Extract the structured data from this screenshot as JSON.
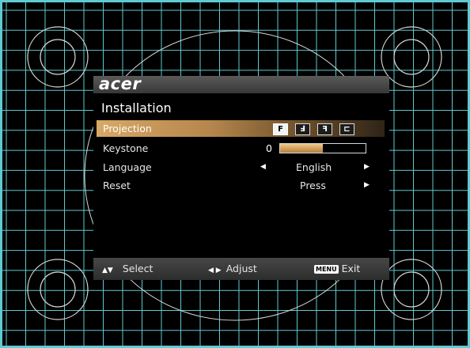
{
  "osd": {
    "brand": "acer",
    "title": "Installation",
    "menu": {
      "projection": {
        "label": "Projection",
        "modes": [
          {
            "icon": "front-desktop-projection-icon",
            "glyph": "F",
            "selected": true
          },
          {
            "icon": "front-ceiling-projection-icon",
            "glyph": "Ⅎ",
            "selected": false
          },
          {
            "icon": "rear-desktop-projection-icon",
            "glyph": "ꟻ",
            "selected": false
          },
          {
            "icon": "rear-ceiling-projection-icon",
            "glyph": "⊏",
            "selected": false
          }
        ]
      },
      "keystone": {
        "label": "Keystone",
        "value": "0",
        "level": 0.5
      },
      "language": {
        "label": "Language",
        "value": "English"
      },
      "reset": {
        "label": "Reset",
        "value": "Press"
      }
    },
    "footer": {
      "select_label": "Select",
      "adjust_label": "Adjust",
      "menu_key": "MENU",
      "exit_label": "Exit"
    }
  },
  "colors": {
    "grid": "#5fcad0",
    "highlight": "#c8975a",
    "keystone_fill": "#d9a25c"
  }
}
